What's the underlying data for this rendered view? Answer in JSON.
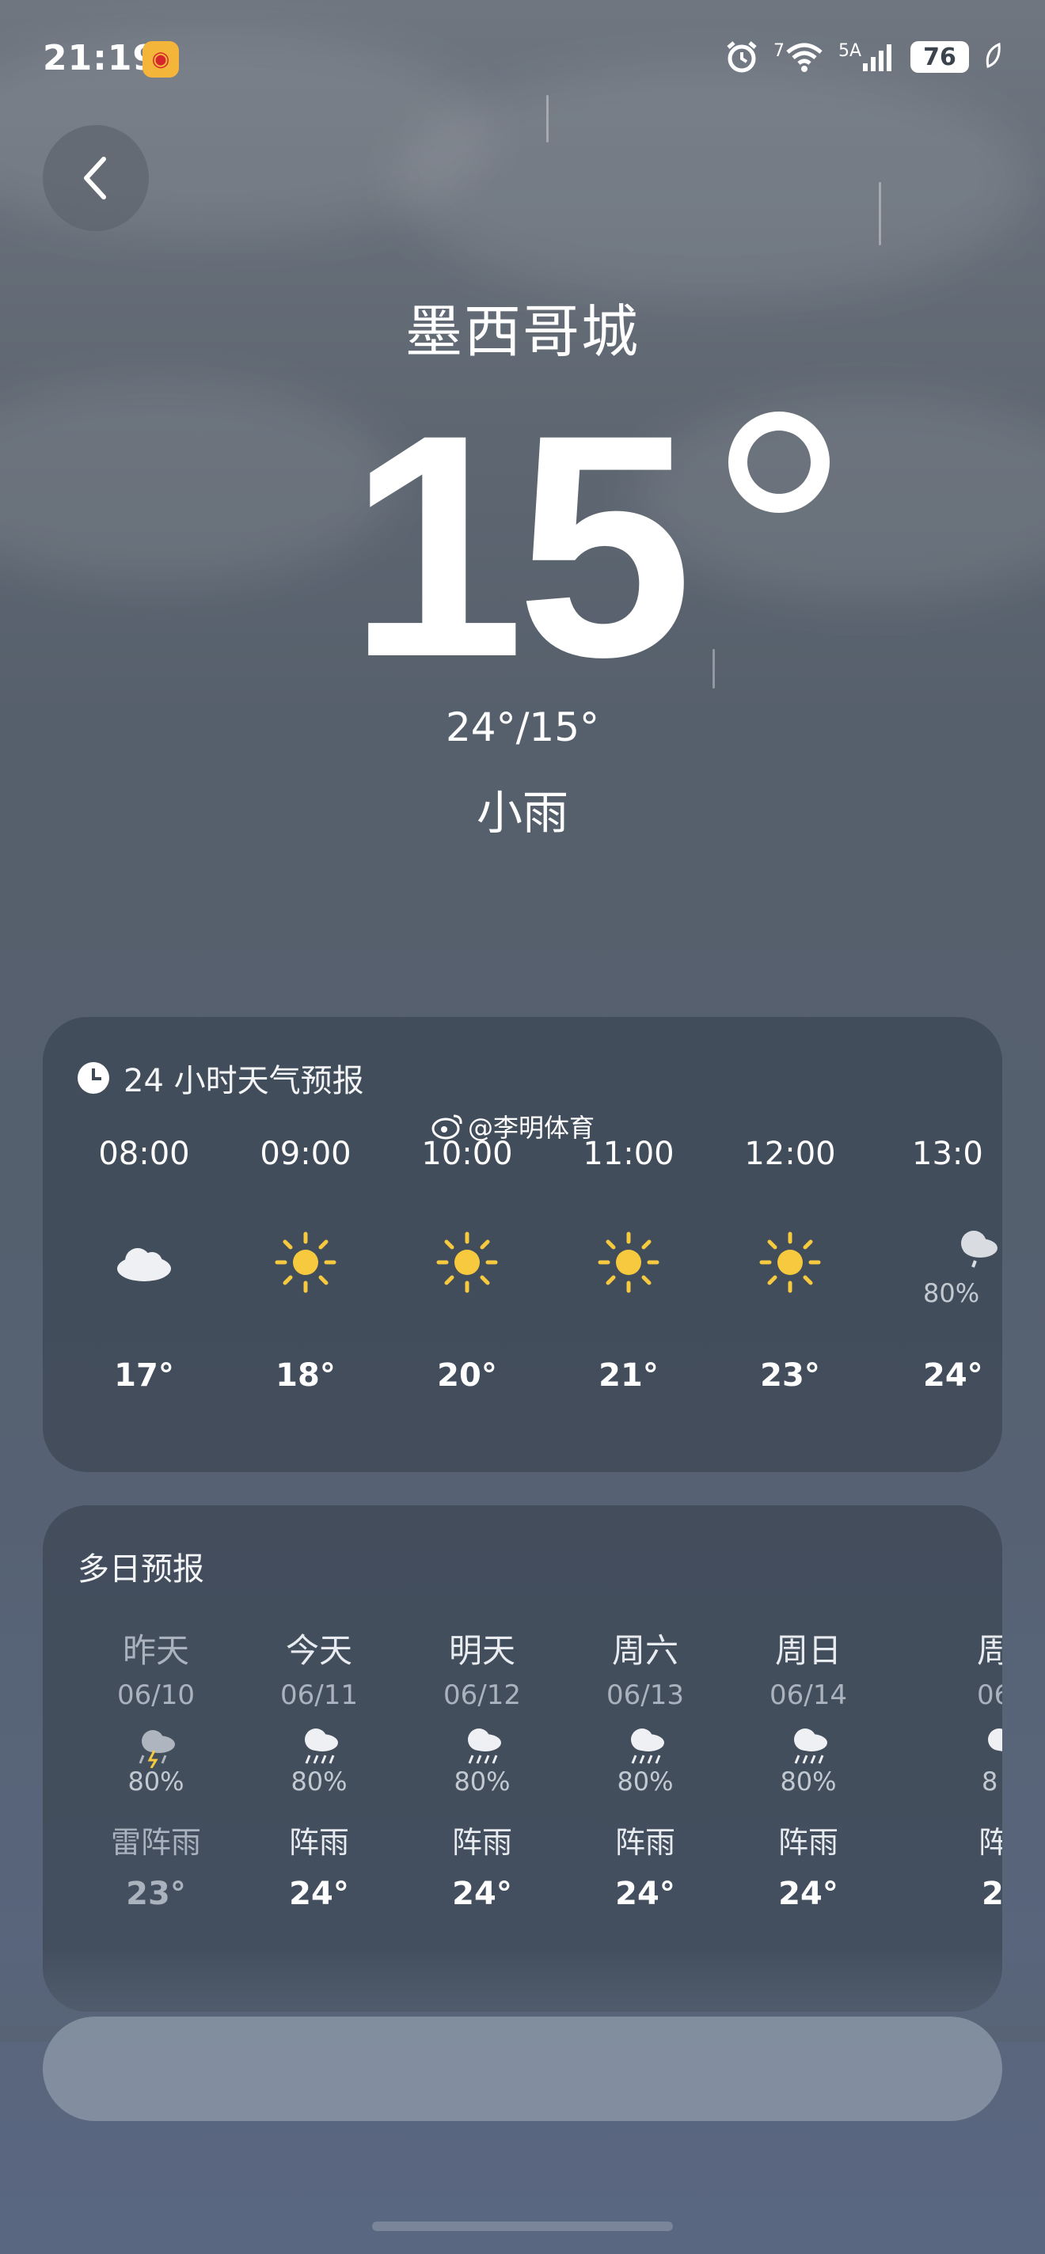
{
  "status_bar": {
    "time": "21:19",
    "alarm_icon": "alarm-icon",
    "wifi_label": "7",
    "signal_label": "5A",
    "battery": "76"
  },
  "header": {
    "city": "墨西哥城",
    "temperature": "15",
    "range": "24°/15°",
    "condition": "小雨"
  },
  "hourly": {
    "title": "24 小时天气预报",
    "items": [
      {
        "time": "08:00",
        "icon": "cloud-icon",
        "temp": "17°"
      },
      {
        "time": "09:00",
        "icon": "sun-icon",
        "temp": "18°"
      },
      {
        "time": "10:00",
        "icon": "sun-icon",
        "temp": "20°"
      },
      {
        "time": "11:00",
        "icon": "sun-icon",
        "temp": "21°"
      },
      {
        "time": "12:00",
        "icon": "sun-icon",
        "temp": "23°"
      },
      {
        "time": "13:0",
        "icon": "rain-cloud-icon",
        "pct": "80%",
        "temp": "24°"
      }
    ]
  },
  "watermark": "@李明体育",
  "daily": {
    "title": "多日预报",
    "items": [
      {
        "name": "昨天",
        "date": "06/10",
        "icon": "thunder-rain-icon",
        "pct": "80%",
        "cond": "雷阵雨",
        "temp": "23°"
      },
      {
        "name": "今天",
        "date": "06/11",
        "icon": "rain-cloud-icon",
        "pct": "80%",
        "cond": "阵雨",
        "temp": "24°"
      },
      {
        "name": "明天",
        "date": "06/12",
        "icon": "rain-cloud-icon",
        "pct": "80%",
        "cond": "阵雨",
        "temp": "24°"
      },
      {
        "name": "周六",
        "date": "06/13",
        "icon": "rain-cloud-icon",
        "pct": "80%",
        "cond": "阵雨",
        "temp": "24°"
      },
      {
        "name": "周日",
        "date": "06/14",
        "icon": "rain-cloud-icon",
        "pct": "80%",
        "cond": "阵雨",
        "temp": "24°"
      },
      {
        "name": "周",
        "date": "06",
        "icon": "rain-cloud-icon",
        "pct": "8",
        "cond": "阵",
        "temp": "2"
      }
    ]
  },
  "colors": {
    "sun": "#f7c93e",
    "card": "#3e4856"
  }
}
